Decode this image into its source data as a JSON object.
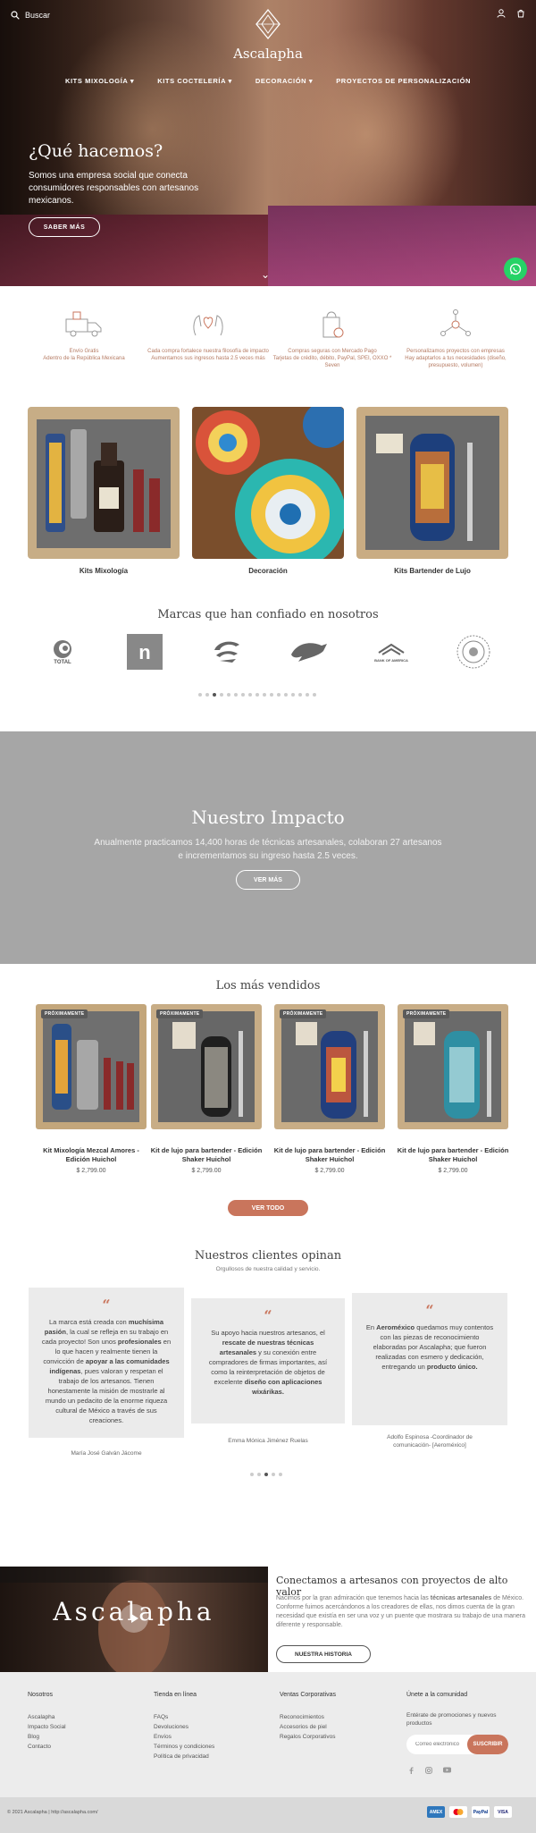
{
  "header": {
    "search_label": "Buscar",
    "logo_text": "Ascalapha",
    "nav": [
      "KITS MIXOLOGÍA ▾",
      "KITS COCTELERÍA ▾",
      "DECORACIÓN ▾",
      "PROYECTOS DE PERSONALIZACIÓN"
    ]
  },
  "hero": {
    "title": "¿Qué hacemos?",
    "subtitle": "Somos una empresa social que conecta consumidores responsables con artesanos mexicanos.",
    "button": "SABER MÁS"
  },
  "features": [
    {
      "icon": "truck-icon",
      "text": "Envío Gratis\nAdentro de la República Mexicana"
    },
    {
      "icon": "hands-icon",
      "text": "Cada compra fortalece nuestra filosofía de impacto\nAumentamos sus ingresos hasta 2.5 veces más"
    },
    {
      "icon": "shopping-bag-icon",
      "text": "Compras seguras con Mercado Pago\nTarjetas de crédito, débito, PayPal, SPEI, OXXO * Seven"
    },
    {
      "icon": "network-icon",
      "text": "Personalizamos proyectos con empresas\nHay adaptarlos a tus necesidades (diseño, presupuesto, volumen)"
    }
  ],
  "categories": [
    "Kits Mixología",
    "Decoración",
    "Kits Bartender de Lujo"
  ],
  "brands": {
    "title": "Marcas que han confiado en nosotros",
    "items": [
      {
        "icon": "total-logo-icon",
        "label": "TOTAL"
      },
      {
        "icon": "natur-logo-icon",
        "label": "natur"
      },
      {
        "icon": "aeromexico-logo-icon",
        "label": ""
      },
      {
        "icon": "broncos-logo-icon",
        "label": ""
      },
      {
        "icon": "bank-of-america-logo-icon",
        "label": "BANK OF AMERICA"
      },
      {
        "icon": "round-emblem-logo-icon",
        "label": ""
      }
    ],
    "dot_count": 17,
    "active_dot": 2
  },
  "impact": {
    "title": "Nuestro Impacto",
    "text_line1": "Anualmente practicamos 14,400 horas de técnicas artesanales, colaboran 27 artesanos",
    "text_line2": "e incrementamos su ingreso hasta 2.5 veces.",
    "button": "VER MÁS"
  },
  "bestsellers": {
    "title": "Los más vendidos",
    "badge": "PRÓXIMAMENTE",
    "items": [
      {
        "name": "Kit Mixología Mezcal Amores - Edición Huichol",
        "price": "$ 2,799.00"
      },
      {
        "name": "Kit de lujo para bartender - Edición Shaker Huichol",
        "price": "$ 2,799.00"
      },
      {
        "name": "Kit de lujo para bartender - Edición Shaker Huichol",
        "price": "$ 2,799.00"
      },
      {
        "name": "Kit de lujo para bartender - Edición Shaker Huichol",
        "price": "$ 2,799.00"
      }
    ],
    "button": "VER TODO"
  },
  "testimonials": {
    "title": "Nuestros clientes opinan",
    "subtitle": "Orgullosos de nuestra calidad y servicio.",
    "items": [
      {
        "p1": "La marca está creada con ",
        "b1": "muchísima pasión",
        "p2": ", la cual se refleja en su trabajo en cada proyecto! Son unos ",
        "b2": "profesionales",
        "p3": " en lo que hacen y realmente tienen la convicción de ",
        "b3": "apoyar a las comunidades indígenas",
        "p4": ", pues valoran y respetan el trabajo de los artesanos. Tienen honestamente la misión de mostrarle al mundo un pedacito de la enorme riqueza cultural de México a través de sus creaciones.",
        "name": "María José Galván Jácome"
      },
      {
        "p1": "Su apoyo hacia nuestros artesanos, el ",
        "b1": "rescate de nuestras técnicas artesanales",
        "p2": " y su conexión entre compradores de firmas importantes, así como la reinterpretación de objetos de excelente ",
        "b2": "diseño con aplicaciones wixárikas.",
        "name": "Emma Mónica Jiménez Ruelas"
      },
      {
        "p1": "En ",
        "b1": "Aeroméxico",
        "p2": " quedamos muy contentos con las piezas de reconocimiento elaboradas por Ascalapha; que fueron realizadas con esmero y dedicación, entregando un ",
        "b2": "producto único.",
        "name": "Adolfo Espinosa -Coordinador de comunicación- [Aeroméxico]"
      }
    ],
    "dot_count": 5,
    "active_dot": 2
  },
  "banner": {
    "video_text": "Ascalapha",
    "title": "Conectamos a artesanos con proyectos de alto valor",
    "text_p1": "Nacimos por la gran admiración que tenemos hacia las ",
    "text_b1": "técnicas artesanales",
    "text_p2": " de México. Conforme fuimos acercándonos a los creadores de ellas, nos dimos cuenta de la gran necesidad que existía en ser una voz y un puente que mostrara su trabajo de una manera diferente y responsable.",
    "button": "NUESTRA HISTORIA"
  },
  "footer": {
    "col1": {
      "title": "Nosotros",
      "links": [
        "Ascalapha",
        "Impacto Social",
        "Blog",
        "Contacto"
      ]
    },
    "col2": {
      "title": "Tienda en línea",
      "links": [
        "FAQs",
        "Devoluciones",
        "Envíos",
        "Términos y condiciones",
        "Política de privacidad"
      ]
    },
    "col3": {
      "title": "Ventas Corporativas",
      "links": [
        "Reconocimientos",
        "Accesorios de piel",
        "Regalos Corporativos"
      ]
    },
    "col4": {
      "title": "Únete a la comunidad",
      "text": "Entérate de promociones y nuevos productos",
      "placeholder": "Correo electrónico",
      "button": "SUSCRIBIR"
    },
    "copyright": "© 2021 Ascalapha | http://ascalapha.com/",
    "payments": [
      "AMEX",
      "MC",
      "PayPal",
      "VISA"
    ]
  }
}
